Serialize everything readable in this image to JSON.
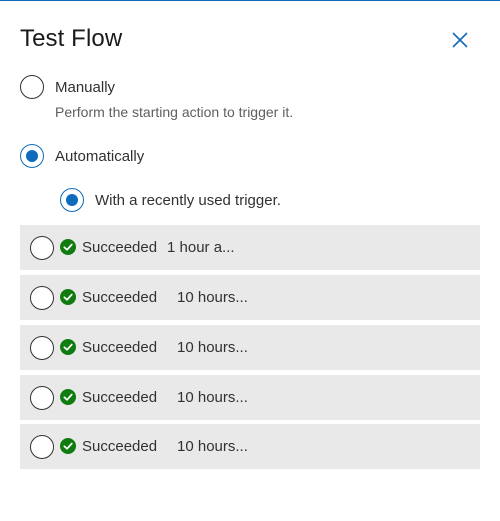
{
  "panel": {
    "title": "Test Flow",
    "close_icon": "close-icon"
  },
  "options": {
    "manual": {
      "label": "Manually",
      "description": "Perform the starting action to trigger it.",
      "selected": false
    },
    "automatic": {
      "label": "Automatically",
      "selected": true,
      "sub_option": {
        "label": "With a recently used trigger.",
        "selected": true
      }
    }
  },
  "runs": [
    {
      "status": "Succeeded",
      "time": "1 hour a...",
      "selected": false
    },
    {
      "status": "Succeeded",
      "time": "10 hours...",
      "selected": false
    },
    {
      "status": "Succeeded",
      "time": "10 hours...",
      "selected": false
    },
    {
      "status": "Succeeded",
      "time": "10 hours...",
      "selected": false
    },
    {
      "status": "Succeeded",
      "time": "10 hours...",
      "selected": false
    }
  ],
  "colors": {
    "accent": "#0f6cbd",
    "success": "#107c10",
    "row_background": "#e9e9e9"
  }
}
